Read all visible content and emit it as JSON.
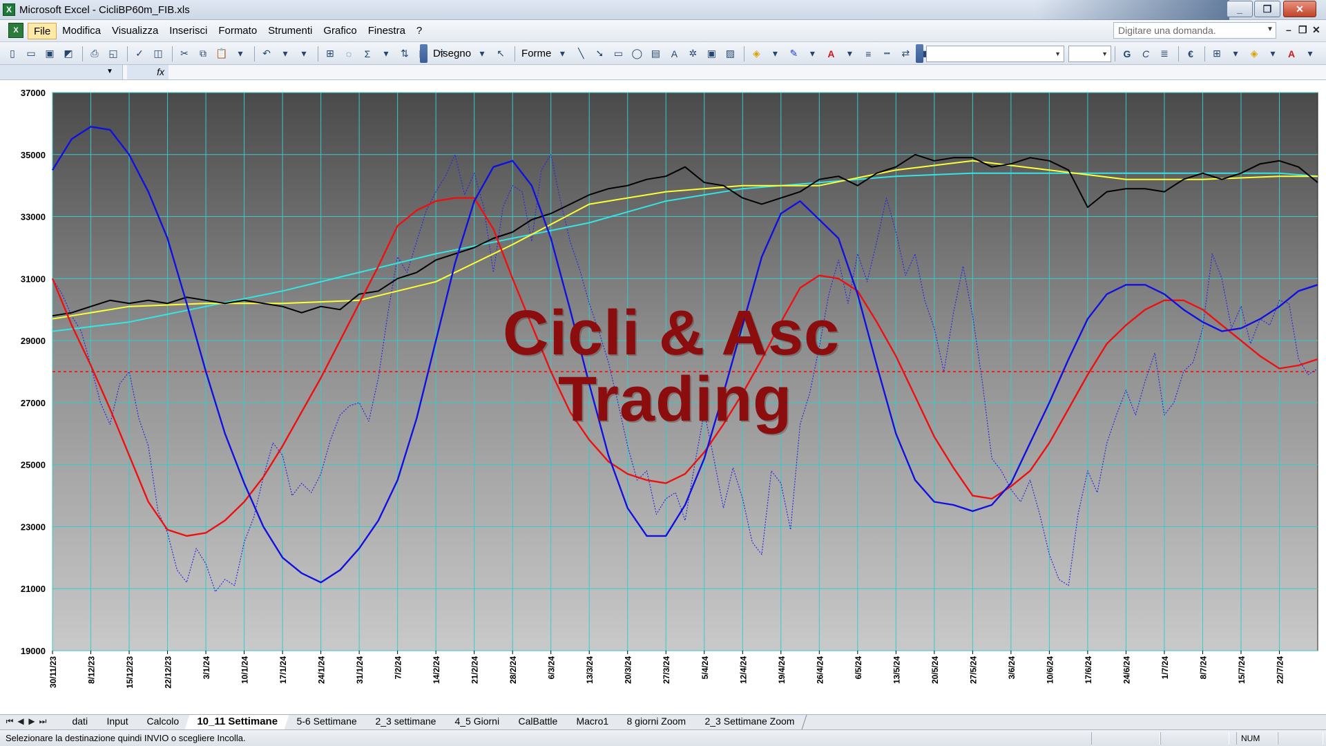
{
  "window": {
    "title": "Microsoft Excel - CicliBP60m_FIB.xls",
    "minimize": "_",
    "maximize": "❐",
    "close": "✕"
  },
  "menu": {
    "items": [
      "File",
      "Modifica",
      "Visualizza",
      "Inserisci",
      "Formato",
      "Strumenti",
      "Grafico",
      "Finestra",
      "?"
    ],
    "active_index": 0,
    "help_placeholder": "Digitare una domanda.",
    "doc_controls": [
      "–",
      "❐",
      "✕"
    ]
  },
  "toolbar": {
    "disegno_label": "Disegno",
    "forme_label": "Forme",
    "font_g": "G",
    "font_c": "C",
    "euro": "€"
  },
  "formula": {
    "fx": "fx"
  },
  "watermark": {
    "line1": "Cicli & Asc",
    "line2": "Trading"
  },
  "sheet_tabs": {
    "tabs": [
      "dati",
      "Input",
      "Calcolo",
      "10_11 Settimane",
      "5-6 Settimane",
      "2_3 settimane",
      "4_5 Giorni",
      "CalBattle",
      "Macro1",
      "8 giorni Zoom",
      "2_3 Settimane Zoom"
    ],
    "active_index": 3
  },
  "status": {
    "message": "Selezionare la destinazione quindi INVIO o scegliere Incolla.",
    "num": "NUM"
  },
  "chart_data": {
    "type": "line",
    "ylim": [
      19000,
      37000
    ],
    "yticks": [
      19000,
      21000,
      23000,
      25000,
      27000,
      29000,
      31000,
      33000,
      35000,
      37000
    ],
    "x_labels": [
      "30/11/23",
      "8/12/23",
      "15/12/23",
      "22/12/23",
      "3/1/24",
      "10/1/24",
      "17/1/24",
      "24/1/24",
      "31/1/24",
      "7/2/24",
      "14/2/24",
      "21/2/24",
      "28/2/24",
      "6/3/24",
      "13/3/24",
      "20/3/24",
      "27/3/24",
      "5/4/24",
      "12/4/24",
      "19/4/24",
      "26/4/24",
      "6/5/24",
      "13/5/24",
      "20/5/24",
      "27/5/24",
      "3/6/24",
      "10/6/24",
      "17/6/24",
      "24/6/24",
      "1/7/24",
      "8/7/24",
      "15/7/24",
      "22/7/24"
    ],
    "x_range": [
      0,
      33
    ],
    "horizontal_ref": 28000,
    "grid": true,
    "colors": {
      "price": "#000000",
      "ma_yellow": "#ffff33",
      "ma_cyan": "#33e6e6",
      "cycle_blue": "#1010e0",
      "cycle_red": "#ee1010",
      "osc_dotted": "#2a2ae0",
      "ref_line": "#ee2020",
      "grid": "#33cccc"
    },
    "series": [
      {
        "key": "price",
        "style": "solid",
        "x": [
          0,
          0.5,
          1,
          1.5,
          2,
          2.5,
          3,
          3.5,
          4,
          4.5,
          5,
          5.5,
          6,
          6.5,
          7,
          7.5,
          8,
          8.5,
          9,
          9.5,
          10,
          10.5,
          11,
          11.5,
          12,
          12.5,
          13,
          13.5,
          14,
          14.5,
          15,
          15.5,
          16,
          16.5,
          17,
          17.5,
          18,
          18.5,
          19,
          19.5,
          20,
          20.5,
          21,
          21.5,
          22,
          22.5,
          23,
          23.5,
          24,
          24.5,
          25,
          25.5,
          26,
          26.5,
          27,
          27.5,
          28,
          28.5,
          29,
          29.5,
          30,
          30.5,
          31,
          31.5,
          32,
          32.5,
          33
        ],
        "y": [
          29800,
          29900,
          30100,
          30300,
          30200,
          30300,
          30200,
          30400,
          30300,
          30200,
          30300,
          30200,
          30100,
          29900,
          30100,
          30000,
          30500,
          30600,
          31000,
          31200,
          31600,
          31800,
          32000,
          32300,
          32500,
          32900,
          33100,
          33400,
          33700,
          33900,
          34000,
          34200,
          34300,
          34600,
          34100,
          34000,
          33600,
          33400,
          33600,
          33800,
          34200,
          34300,
          34000,
          34400,
          34600,
          35000,
          34800,
          34900,
          34900,
          34600,
          34700,
          34900,
          34800,
          34500,
          33300,
          33800,
          33900,
          33900,
          33800,
          34200,
          34400,
          34200,
          34400,
          34700,
          34800,
          34600,
          34100
        ]
      },
      {
        "key": "ma_yellow",
        "style": "solid",
        "x": [
          0,
          2,
          4,
          6,
          8,
          10,
          12,
          14,
          16,
          18,
          20,
          22,
          24,
          26,
          28,
          30,
          32,
          33
        ],
        "y": [
          29700,
          30100,
          30200,
          30200,
          30300,
          30900,
          32100,
          33400,
          33800,
          34000,
          34000,
          34500,
          34800,
          34500,
          34200,
          34200,
          34300,
          34300
        ]
      },
      {
        "key": "ma_cyan",
        "style": "solid",
        "x": [
          0,
          2,
          4,
          6,
          8,
          10,
          12,
          14,
          16,
          18,
          20,
          22,
          24,
          26,
          28,
          30,
          32,
          33
        ],
        "y": [
          29300,
          29600,
          30100,
          30600,
          31200,
          31800,
          32300,
          32800,
          33500,
          33900,
          34100,
          34300,
          34400,
          34400,
          34400,
          34400,
          34400,
          34300
        ]
      },
      {
        "key": "cycle_blue",
        "style": "solid",
        "x": [
          0,
          0.5,
          1,
          1.5,
          2,
          2.5,
          3,
          3.5,
          4,
          4.5,
          5,
          5.5,
          6,
          6.5,
          7,
          7.5,
          8,
          8.5,
          9,
          9.5,
          10,
          10.5,
          11,
          11.5,
          12,
          12.5,
          13,
          13.5,
          14,
          14.5,
          15,
          15.5,
          16,
          16.5,
          17,
          17.5,
          18,
          18.5,
          19,
          19.5,
          20,
          20.5,
          21,
          21.5,
          22,
          22.5,
          23,
          23.5,
          24,
          24.5,
          25,
          25.5,
          26,
          26.5,
          27,
          27.5,
          28,
          28.5,
          29,
          29.5,
          30,
          30.5,
          31,
          31.5,
          32,
          32.5,
          33
        ],
        "y": [
          34500,
          35500,
          35900,
          35800,
          35000,
          33800,
          32300,
          30200,
          28000,
          26000,
          24400,
          23000,
          22000,
          21500,
          21200,
          21600,
          22300,
          23200,
          24500,
          26500,
          29000,
          31500,
          33500,
          34600,
          34800,
          34000,
          32300,
          30000,
          27600,
          25300,
          23600,
          22700,
          22700,
          23700,
          25200,
          27300,
          29500,
          31700,
          33100,
          33500,
          32900,
          32300,
          30500,
          28200,
          26000,
          24500,
          23800,
          23700,
          23500,
          23700,
          24400,
          25700,
          27000,
          28400,
          29700,
          30500,
          30800,
          30800,
          30500,
          30000,
          29600,
          29300,
          29400,
          29700,
          30100,
          30600,
          30800
        ]
      },
      {
        "key": "cycle_red",
        "style": "solid",
        "x": [
          0,
          0.5,
          1,
          1.5,
          2,
          2.5,
          3,
          3.5,
          4,
          4.5,
          5,
          5.5,
          6,
          6.5,
          7,
          7.5,
          8,
          8.5,
          9,
          9.5,
          10,
          10.5,
          11,
          11.5,
          12,
          12.5,
          13,
          13.5,
          14,
          14.5,
          15,
          15.5,
          16,
          16.5,
          17,
          17.5,
          18,
          18.5,
          19,
          19.5,
          20,
          20.5,
          21,
          21.5,
          22,
          22.5,
          23,
          23.5,
          24,
          24.5,
          25,
          25.5,
          26,
          26.5,
          27,
          27.5,
          28,
          28.5,
          29,
          29.5,
          30,
          30.5,
          31,
          31.5,
          32,
          32.5,
          33
        ],
        "y": [
          31000,
          29500,
          28200,
          26800,
          25300,
          23800,
          22900,
          22700,
          22800,
          23200,
          23800,
          24600,
          25600,
          26700,
          27800,
          29000,
          30200,
          31400,
          32700,
          33200,
          33500,
          33600,
          33600,
          32600,
          31000,
          29500,
          28000,
          26700,
          25800,
          25100,
          24700,
          24500,
          24400,
          24700,
          25400,
          26300,
          27300,
          28400,
          29600,
          30700,
          31100,
          31000,
          30600,
          29600,
          28500,
          27200,
          25900,
          24900,
          24000,
          23900,
          24300,
          24800,
          25700,
          26800,
          27900,
          28900,
          29500,
          30000,
          30300,
          30300,
          30000,
          29500,
          29000,
          28500,
          28100,
          28200,
          28400
        ]
      },
      {
        "key": "osc_dotted",
        "style": "dotted",
        "x": [
          0,
          0.25,
          0.5,
          0.75,
          1,
          1.25,
          1.5,
          1.75,
          2,
          2.25,
          2.5,
          2.75,
          3,
          3.25,
          3.5,
          3.75,
          4,
          4.25,
          4.5,
          4.75,
          5,
          5.25,
          5.5,
          5.75,
          6,
          6.25,
          6.5,
          6.75,
          7,
          7.25,
          7.5,
          7.75,
          8,
          8.25,
          8.5,
          8.75,
          9,
          9.25,
          9.5,
          9.75,
          10,
          10.25,
          10.5,
          10.75,
          11,
          11.25,
          11.5,
          11.75,
          12,
          12.25,
          12.5,
          12.75,
          13,
          13.25,
          13.5,
          13.75,
          14,
          14.25,
          14.5,
          14.75,
          15,
          15.25,
          15.5,
          15.75,
          16,
          16.25,
          16.5,
          16.75,
          17,
          17.25,
          17.5,
          17.75,
          18,
          18.25,
          18.5,
          18.75,
          19,
          19.25,
          19.5,
          19.75,
          20,
          20.25,
          20.5,
          20.75,
          21,
          21.25,
          21.5,
          21.75,
          22,
          22.25,
          22.5,
          22.75,
          23,
          23.25,
          23.5,
          23.75,
          24,
          24.25,
          24.5,
          24.75,
          25,
          25.25,
          25.5,
          25.75,
          26,
          26.25,
          26.5,
          26.75,
          27,
          27.25,
          27.5,
          27.75,
          28,
          28.25,
          28.5,
          28.75,
          29,
          29.25,
          29.5,
          29.75,
          30,
          30.25,
          30.5,
          30.75,
          31,
          31.25,
          31.5,
          31.75,
          32,
          32.25,
          32.5,
          32.75,
          33
        ],
        "y": [
          31000,
          30500,
          29800,
          29300,
          28200,
          27000,
          26300,
          27600,
          28000,
          26500,
          25600,
          23500,
          22800,
          21600,
          21200,
          22300,
          21800,
          20900,
          21300,
          21100,
          22500,
          23300,
          24600,
          25700,
          25300,
          24000,
          24400,
          24100,
          24700,
          25800,
          26600,
          26900,
          27000,
          26400,
          27800,
          29900,
          31700,
          31200,
          32200,
          33200,
          33800,
          34300,
          35000,
          33700,
          34400,
          33300,
          31200,
          33300,
          34000,
          33800,
          32200,
          34500,
          35000,
          33500,
          32200,
          31300,
          30200,
          29300,
          28300,
          27000,
          25600,
          24500,
          24800,
          23400,
          23900,
          24100,
          23200,
          25000,
          26700,
          25200,
          23600,
          24900,
          23900,
          22500,
          22100,
          24800,
          24400,
          22900,
          26300,
          27300,
          28800,
          30500,
          31600,
          30200,
          31800,
          30900,
          32200,
          33600,
          32500,
          31100,
          31800,
          30300,
          29400,
          28000,
          29900,
          31400,
          29800,
          27700,
          25200,
          24800,
          24200,
          23800,
          24500,
          23400,
          22100,
          21300,
          21100,
          23400,
          24800,
          24100,
          25700,
          26600,
          27400,
          26600,
          27700,
          28600,
          26600,
          27000,
          28000,
          28300,
          29400,
          31800,
          31000,
          29400,
          30100,
          28900,
          29700,
          29500,
          30300,
          30200,
          28400,
          27900,
          28100
        ]
      }
    ]
  }
}
